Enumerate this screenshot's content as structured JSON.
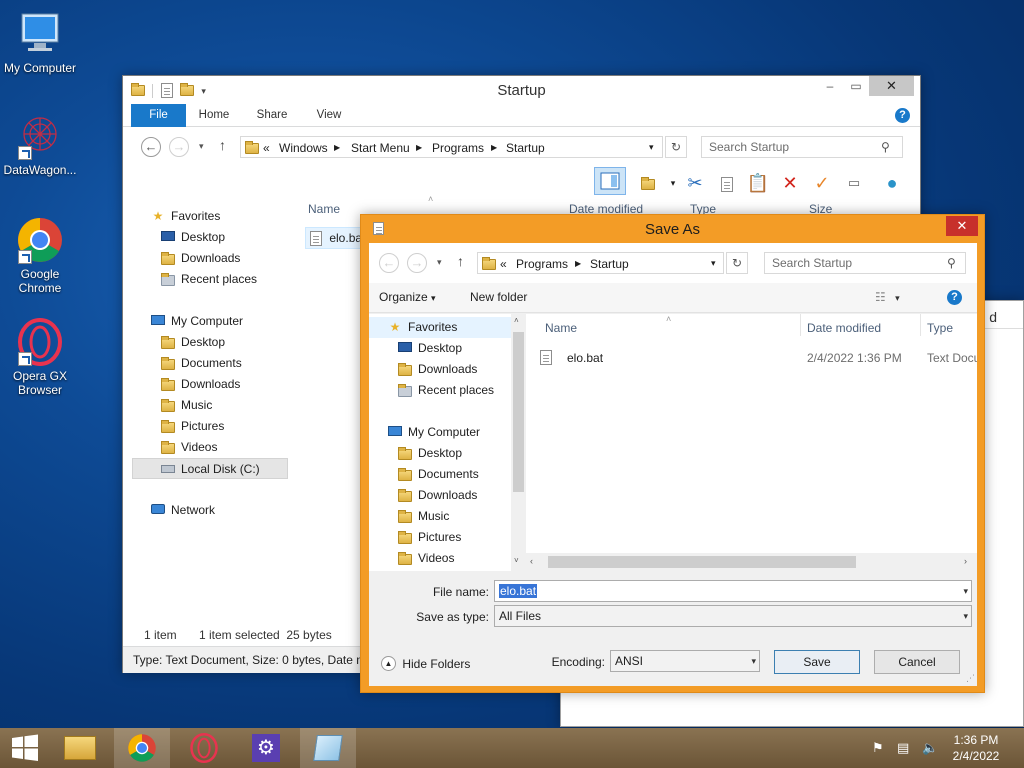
{
  "desktop": {
    "icons": [
      {
        "label": "My Computer",
        "icon": "my-computer-icon"
      },
      {
        "label": "DataWagon...",
        "icon": "datawagon-icon"
      },
      {
        "label": "Google Chrome",
        "icon": "chrome-icon"
      },
      {
        "label": "Opera GX Browser",
        "icon": "opera-gx-icon"
      }
    ]
  },
  "explorer": {
    "title": "Startup",
    "tabs": {
      "file": "File",
      "home": "Home",
      "share": "Share",
      "view": "View"
    },
    "address": {
      "prefix": "«",
      "crumbs": [
        "Windows",
        "Start Menu",
        "Programs",
        "Startup"
      ]
    },
    "search_placeholder": "Search Startup",
    "columns": {
      "name": "Name",
      "date": "Date modified",
      "type": "Type",
      "size": "Size"
    },
    "file_name": "elo.bat",
    "nav": {
      "favorites": "Favorites",
      "fav_items": [
        "Desktop",
        "Downloads",
        "Recent places"
      ],
      "computer": "My Computer",
      "computer_items": [
        "Desktop",
        "Documents",
        "Downloads",
        "Music",
        "Pictures",
        "Videos",
        "Local Disk (C:)"
      ],
      "network": "Network"
    },
    "status": {
      "count": "1 item",
      "selected": "1 item selected  25 bytes"
    },
    "details": "Type: Text Document, Size: 0 bytes, Date m"
  },
  "notepad": {
    "partial_text": "d"
  },
  "saveas": {
    "title": "Save As",
    "address": {
      "prefix": "«",
      "crumbs": [
        "Programs",
        "Startup"
      ]
    },
    "search_placeholder": "Search Startup",
    "toolbar": {
      "organize": "Organize",
      "new_folder": "New folder"
    },
    "nav": {
      "favorites": "Favorites",
      "fav_items": [
        "Desktop",
        "Downloads",
        "Recent places"
      ],
      "computer": "My Computer",
      "computer_items": [
        "Desktop",
        "Documents",
        "Downloads",
        "Music",
        "Pictures",
        "Videos"
      ]
    },
    "columns": {
      "name": "Name",
      "date": "Date modified",
      "type": "Type"
    },
    "file": {
      "name": "elo.bat",
      "date": "2/4/2022 1:36 PM",
      "type": "Text Docu"
    },
    "file_name_label": "File name:",
    "file_name_value": "elo.bat",
    "save_type_label": "Save as type:",
    "save_type_value": "All Files",
    "hide_folders": "Hide Folders",
    "encoding_label": "Encoding:",
    "encoding_value": "ANSI",
    "save_button": "Save",
    "cancel_button": "Cancel"
  },
  "taskbar": {
    "time": "1:36 PM",
    "date": "2/4/2022"
  },
  "colors": {
    "accent": "#1979ca",
    "dialog_frame": "#f39c26",
    "taskbar": "#7a6344"
  }
}
